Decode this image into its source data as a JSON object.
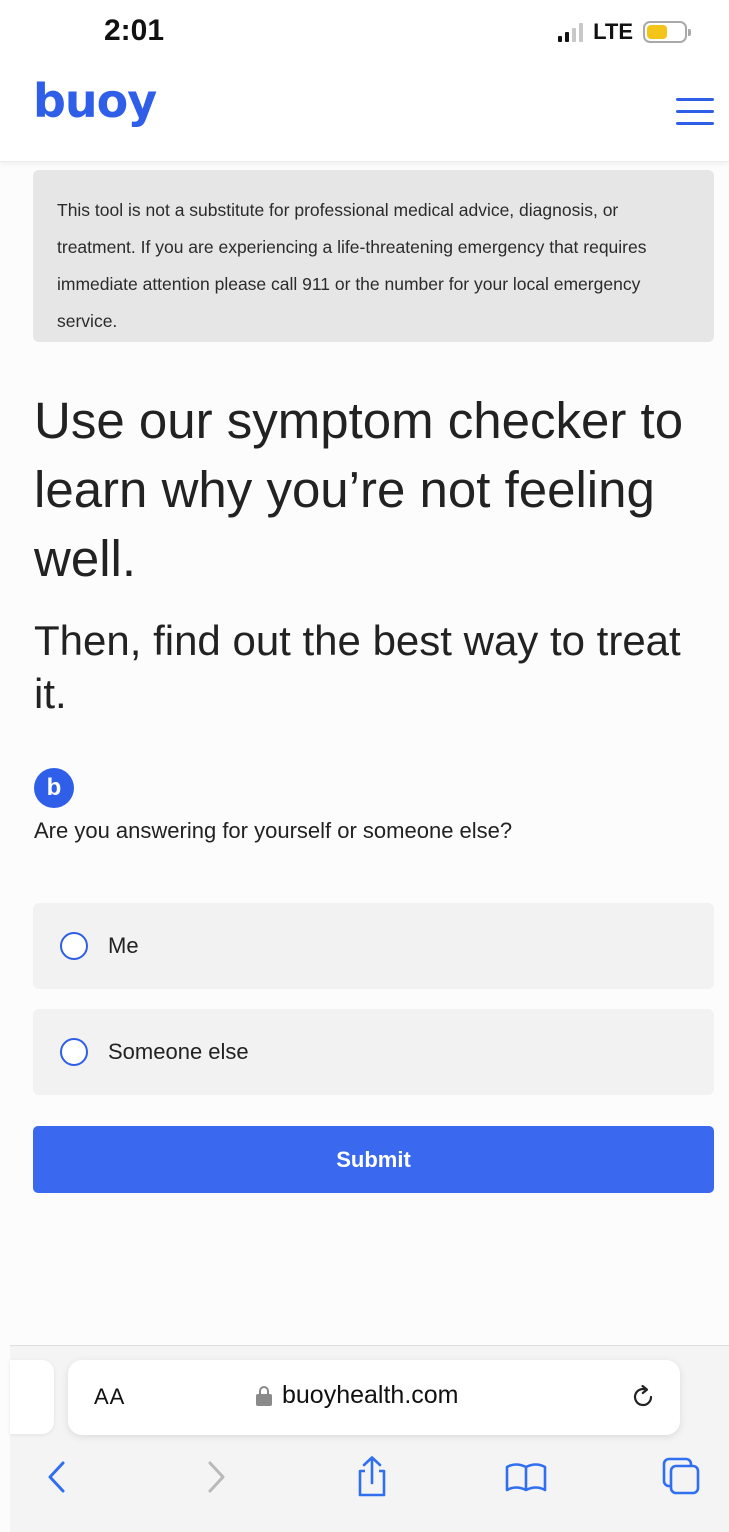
{
  "status_bar": {
    "time": "2:01",
    "network": "LTE"
  },
  "header": {
    "logo": "buoy",
    "menu_icon": "hamburger-menu-icon"
  },
  "disclaimer": {
    "text": "This tool is not a substitute for professional medical advice, diagnosis, or treatment. If you are experiencing a life-threatening emergency that requires immediate attention please call 911 or the number for your local emergency service."
  },
  "hero": {
    "title": "Use our symptom checker to learn why you’re not feeling well.",
    "subtitle": "Then, find out the best way to treat it."
  },
  "chat": {
    "avatar_letter": "b",
    "question": "Are you answering for yourself or someone else?",
    "options": [
      {
        "label": "Me"
      },
      {
        "label": "Someone else"
      }
    ],
    "submit_label": "Submit"
  },
  "browser": {
    "text_size_label": "AA",
    "url": "buoyhealth.com",
    "toolbar_icons": [
      "back-icon",
      "forward-icon",
      "share-icon",
      "bookmarks-icon",
      "tabs-icon"
    ]
  },
  "colors": {
    "brand": "#2f5ee8",
    "submit": "#3a69ef",
    "battery": "#f5c418"
  }
}
